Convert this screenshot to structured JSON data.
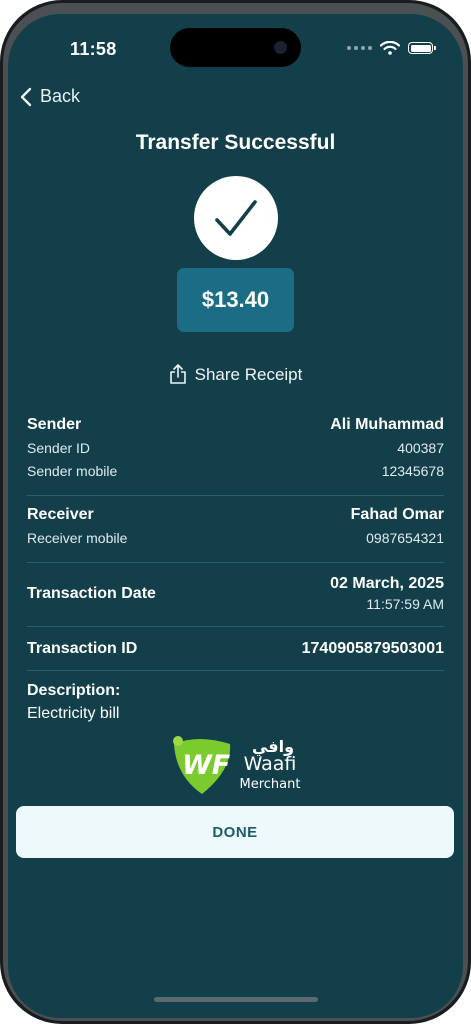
{
  "status_bar": {
    "time": "11:58"
  },
  "nav": {
    "back_label": "Back"
  },
  "header": {
    "title": "Transfer Successful"
  },
  "amount": "$13.40",
  "share_label": "Share Receipt",
  "sender": {
    "label": "Sender",
    "name": "Ali Muhammad",
    "id_label": "Sender ID",
    "id_value": "400387",
    "mobile_label": "Sender mobile",
    "mobile_value": "12345678"
  },
  "receiver": {
    "label": "Receiver",
    "name": "Fahad Omar",
    "mobile_label": "Receiver mobile",
    "mobile_value": "0987654321"
  },
  "transaction": {
    "date_label": "Transaction Date",
    "date_value": "02 March, 2025",
    "time_value": "11:57:59 AM",
    "id_label": "Transaction ID",
    "id_value": "1740905879503001"
  },
  "description": {
    "label": "Description:",
    "value": "Electricity bill"
  },
  "logo": {
    "mark": "WF",
    "arabic": "وافي",
    "name": "Waafi",
    "sub": "Merchant"
  },
  "done_label": "DONE",
  "colors": {
    "background": "#133f4b",
    "amount_box": "#1b6d86",
    "button": "#eef9fb",
    "logo_green": "#7ccb2e"
  }
}
